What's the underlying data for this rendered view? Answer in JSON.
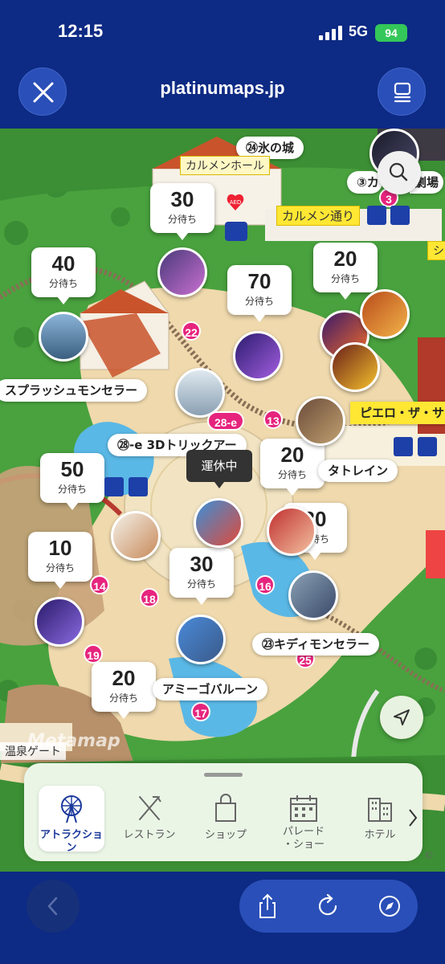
{
  "status_bar": {
    "time": "12:15",
    "network": "5G",
    "battery": "94"
  },
  "browser": {
    "title": "platinumaps.jp"
  },
  "map": {
    "wait_times": [
      {
        "id": "w30a",
        "minutes": "30",
        "unit": "分待ち"
      },
      {
        "id": "w40",
        "minutes": "40",
        "unit": "分待ち"
      },
      {
        "id": "w70",
        "minutes": "70",
        "unit": "分待ち"
      },
      {
        "id": "w20a",
        "minutes": "20",
        "unit": "分待ち"
      },
      {
        "id": "w20b",
        "minutes": "20",
        "unit": "分待ち"
      },
      {
        "id": "w50",
        "minutes": "50",
        "unit": "分待ち"
      },
      {
        "id": "w30b",
        "minutes": "30",
        "unit": "分待ち"
      },
      {
        "id": "w10",
        "minutes": "10",
        "unit": "分待ち"
      },
      {
        "id": "w30c",
        "minutes": "30",
        "unit": "分待ち"
      },
      {
        "id": "w20c",
        "minutes": "20",
        "unit": "分待ち"
      }
    ],
    "attraction_labels": [
      "㉔氷の城",
      "③カ",
      "劇場",
      "スプラッシュモンセラー",
      "ピエロ・ザ・サ",
      "㉘-e 3Dトリックアー",
      "タトレイン",
      "㉓キディモンセラー",
      "アミーゴバルーン"
    ],
    "area_signs": [
      "カルメンホール",
      "カルメン通り",
      "シ",
      "温泉ゲート"
    ],
    "pins": [
      "22",
      "28-e",
      "13",
      "14",
      "18",
      "16",
      "19",
      "17",
      "25",
      "3"
    ],
    "closed_tooltip": "運休中",
    "watermark": "Metamap",
    "icons": [
      "search-icon",
      "locate-arrow-icon",
      "aed-icon",
      "wifi-icon",
      "restroom-icon",
      "wheelchair-icon"
    ]
  },
  "categories": {
    "items": [
      {
        "label": "アトラクション",
        "icon": "ferris-wheel-icon",
        "active": true
      },
      {
        "label": "レストラン",
        "icon": "fork-knife-icon",
        "active": false
      },
      {
        "label": "ショップ",
        "icon": "shopping-bag-icon",
        "active": false
      },
      {
        "label": "パレード\n・ショー",
        "label_line1": "パレード",
        "label_line2": "・ショー",
        "icon": "calendar-icon",
        "active": false
      },
      {
        "label": "ホテル",
        "icon": "hotel-icon",
        "active": false
      }
    ],
    "copyright": "©"
  },
  "colors": {
    "brand": "#0d2a84",
    "accent": "#2a4fb8",
    "pin": "#e6247d",
    "battery": "#34c759"
  }
}
